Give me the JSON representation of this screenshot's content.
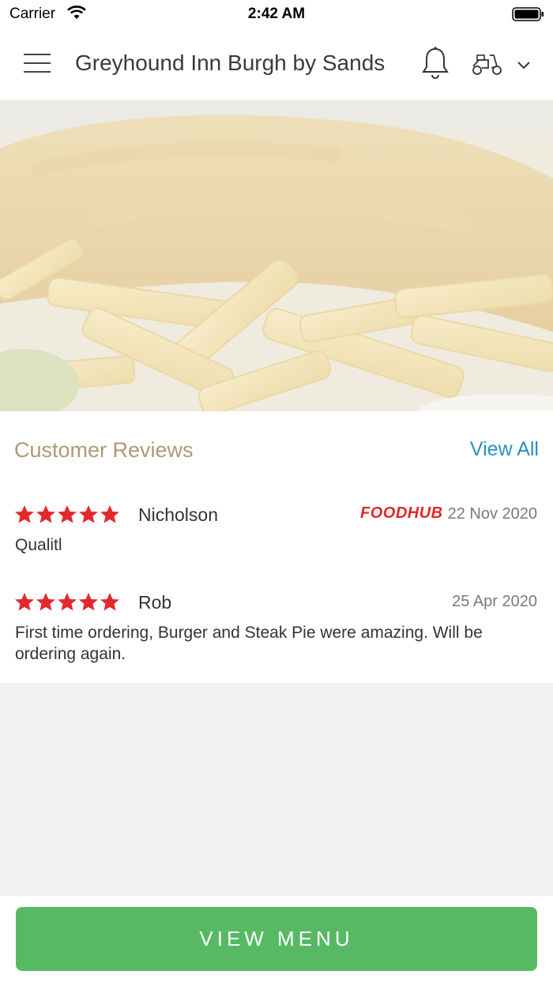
{
  "status_bar": {
    "carrier": "Carrier",
    "time": "2:42 AM"
  },
  "header": {
    "title": "Greyhound Inn Burgh by Sands",
    "icons": [
      "menu-icon",
      "bell-icon",
      "scooter-icon",
      "chevron-down-icon"
    ]
  },
  "hero": {
    "image": "fish-and-chips-photo"
  },
  "reviews": {
    "title": "Customer Reviews",
    "view_all": "View All",
    "items": [
      {
        "rating": 5,
        "name": "Nicholson",
        "source": "FOODHUB",
        "date": "22 Nov 2020",
        "text": "Qualitl"
      },
      {
        "rating": 5,
        "name": "Rob",
        "date": "25 Apr 2020",
        "text": "First time ordering, Burger and Steak Pie were amazing. Will be ordering again."
      }
    ]
  },
  "footer": {
    "button_label": "VIEW MENU"
  },
  "colors": {
    "accent_green": "#57b964",
    "link_blue": "#2b8fbd",
    "title_tan": "#ac9a77",
    "star_red": "#e3282b",
    "foodhub_red": "#e0282e"
  }
}
